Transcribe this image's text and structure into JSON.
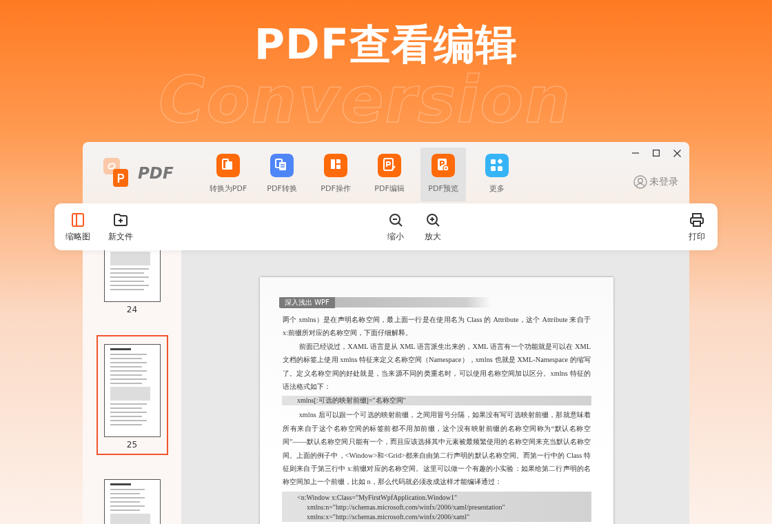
{
  "banner": {
    "title": "PDF查看编辑",
    "backdrop_text": "Conversion"
  },
  "app": {
    "logo_text": "PDF",
    "tools": [
      {
        "label": "转换为PDF",
        "kind": "to-pdf",
        "color": "#ff6a0a",
        "selected": false
      },
      {
        "label": "PDF转换",
        "kind": "convert",
        "color": "#4f86f7",
        "selected": false
      },
      {
        "label": "PDF操作",
        "kind": "operate",
        "color": "#ff6a0a",
        "selected": false
      },
      {
        "label": "PDF编辑",
        "kind": "edit",
        "color": "#ff6a0a",
        "selected": false
      },
      {
        "label": "PDF预览",
        "kind": "preview",
        "color": "#ff6a0a",
        "selected": true
      },
      {
        "label": "更多",
        "kind": "more",
        "color": "#36b4f6",
        "selected": false
      }
    ],
    "account": {
      "label": "未登录"
    }
  },
  "toolbar": {
    "left": [
      {
        "label": "缩略图",
        "kind": "thumbnails",
        "selected": true
      },
      {
        "label": "新文件",
        "kind": "new-file",
        "selected": false
      }
    ],
    "center": [
      {
        "label": "缩小",
        "kind": "zoom-out",
        "selected": false
      },
      {
        "label": "放大",
        "kind": "zoom-in",
        "selected": false
      }
    ],
    "right": [
      {
        "label": "打印",
        "kind": "print",
        "selected": false
      }
    ]
  },
  "thumbnails": [
    {
      "label": "24",
      "selected": false
    },
    {
      "label": "25",
      "selected": true
    },
    {
      "selected": false
    }
  ],
  "document": {
    "running_head": "深入浅出 WPF",
    "blocks": [
      {
        "kind": "para",
        "indent": false,
        "text": "两个 xmlns）是在声明名称空间，最上面一行是在使用名为 Class 的 Attribute，这个 Attribute 来自于 x:前缀所对应的名称空间，下面仔细解释。"
      },
      {
        "kind": "para",
        "indent": true,
        "text": "前面已经说过，XAML 语言是从 XML 语言派生出来的，XML 语言有一个功能就是可以在 XML 文档的标签上使用 xmlns 特征来定义名称空间（Namespace），xmlns 也就是 XML-Namespace 的缩写了。定义名称空间的好处就是，当来源不同的类重名时，可以使用名称空间加以区分。xmlns 特征的语法格式如下："
      },
      {
        "kind": "code",
        "lines": [
          "xmlns[:可选的映射前缀]=\"名称空间\""
        ]
      },
      {
        "kind": "para",
        "indent": true,
        "text": "xmlns 后可以跟一个可选的映射前缀，之间用冒号分隔，如果没有写可选映射前缀，那就意味着所有来自于这个名称空间的标签前都不用加前缀，这个没有映射前缀的名称空间称为“默认名称空间”——默认名称空间只能有一个，而且应该选择其中元素被最频繁使用的名称空间来充当默认名称空间。上面的例子中，<Window>和<Grid>都来自由第二行声明的默认名称空间。而第一行中的 Class 特征则来自于第三行中 x:前缀对应的名称空间。这里可以做一个有趣的小实验：如果给第二行声明的名称空间加上一个前缀，比如 n，那么代码就必须改成这样才能编译通过："
      },
      {
        "kind": "code",
        "lines": [
          "<n:Window x:Class=\"MyFirstWpfApplication.Window1\"",
          "xmlns:n=\"http://schemas.microsoft.com/winfx/2006/xaml/presentation\"",
          "xmlns:x=\"http://schemas.microsoft.com/winfx/2006/xaml\""
        ]
      }
    ]
  }
}
